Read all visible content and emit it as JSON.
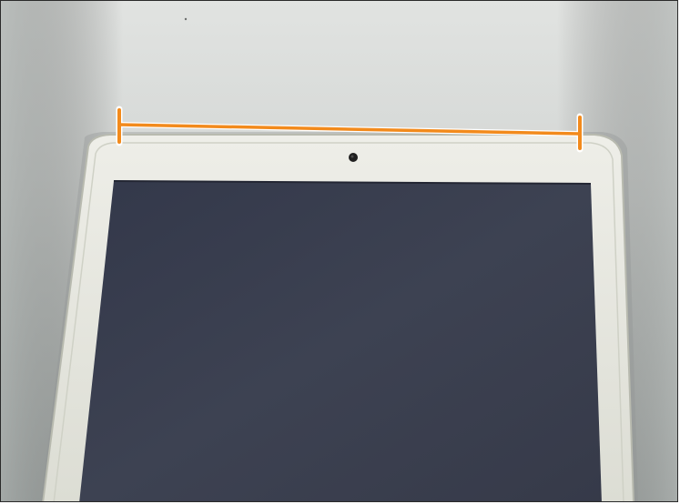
{
  "photo": {
    "subject": "tablet-top-edge",
    "colors": {
      "wall_light": "#d8dad8",
      "wall_dark": "#9fa4a2",
      "bezel": "#e6e7df",
      "bezel_edge": "#b9bbb0",
      "screen": "#3a3f4f",
      "screen_dark": "#2d3140",
      "camera": "#202020",
      "annotation": "#f28a1c",
      "annotation_outline": "#ffffff"
    },
    "annotation": {
      "type": "measurement-bracket",
      "label": ""
    }
  }
}
